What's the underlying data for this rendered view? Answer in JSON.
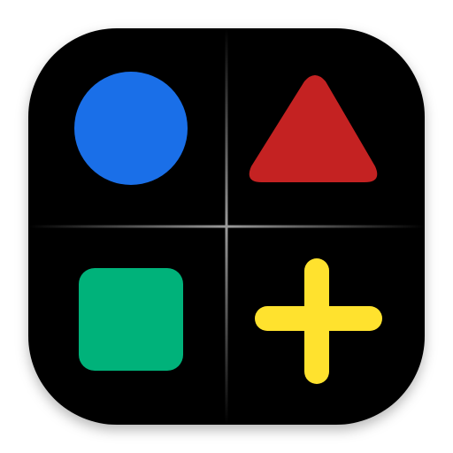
{
  "app_icon": {
    "icon_name": "shapes-app-icon",
    "background_color": "#000000",
    "divider_color": "#9a9a9a",
    "quadrants": [
      {
        "shape": "circle",
        "icon": "circle-icon",
        "color": "#1a6fe8"
      },
      {
        "shape": "triangle",
        "icon": "triangle-icon",
        "color": "#c42222"
      },
      {
        "shape": "square",
        "icon": "square-icon",
        "color": "#00b27a"
      },
      {
        "shape": "plus",
        "icon": "plus-icon",
        "color": "#ffe22e"
      }
    ]
  }
}
